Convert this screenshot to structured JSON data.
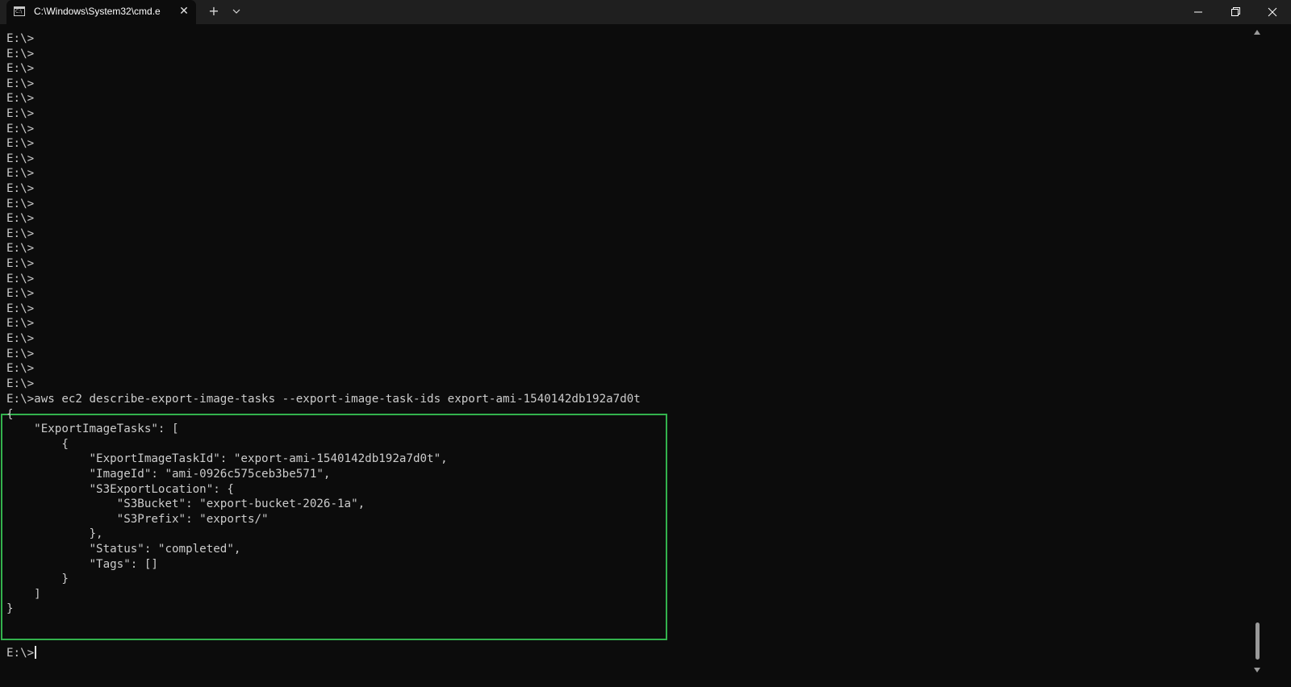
{
  "tab": {
    "icon": "cmd-icon",
    "icon_text": "C:\\",
    "title": "C:\\Windows\\System32\\cmd.e",
    "close_glyph": "✕"
  },
  "titlebar": {
    "new_tab_glyph": "+"
  },
  "terminal": {
    "prompt_lines": [
      "E:\\>",
      "E:\\>",
      "E:\\>",
      "E:\\>",
      "E:\\>",
      "E:\\>",
      "E:\\>",
      "E:\\>",
      "E:\\>",
      "E:\\>",
      "E:\\>",
      "E:\\>",
      "E:\\>",
      "E:\\>",
      "E:\\>",
      "E:\\>",
      "E:\\>",
      "E:\\>",
      "E:\\>",
      "E:\\>",
      "E:\\>",
      "E:\\>",
      "E:\\>",
      "E:\\>"
    ],
    "command_output": [
      "E:\\>aws ec2 describe-export-image-tasks --export-image-task-ids export-ami-1540142db192a7d0t",
      "{",
      "    \"ExportImageTasks\": [",
      "        {",
      "            \"ExportImageTaskId\": \"export-ami-1540142db192a7d0t\",",
      "            \"ImageId\": \"ami-0926c575ceb3be571\",",
      "            \"S3ExportLocation\": {",
      "                \"S3Bucket\": \"export-bucket-2026-1a\",",
      "                \"S3Prefix\": \"exports/\"",
      "            },",
      "            \"Status\": \"completed\",",
      "            \"Tags\": []",
      "        }",
      "    ]",
      "}"
    ],
    "current_prompt": "E:\\>"
  },
  "colors": {
    "background": "#0c0c0c",
    "text": "#cccccc",
    "highlight_border": "#33b24d",
    "titlebar": "#1f1f1f"
  }
}
